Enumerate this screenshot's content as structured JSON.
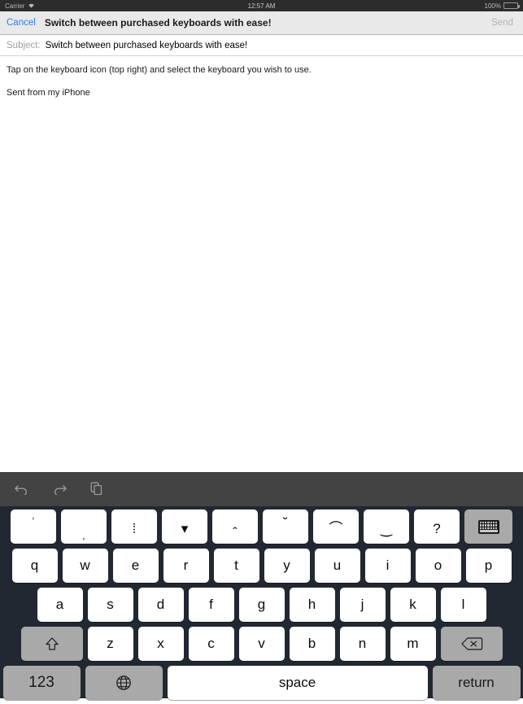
{
  "status_bar": {
    "carrier": "Carrier",
    "wifi_icon": "wifi-icon",
    "time": "12:57 AM",
    "battery_percent": "100%",
    "battery_icon": "battery-full-icon"
  },
  "nav_bar": {
    "cancel_label": "Cancel",
    "title": "Switch between purchased keyboards with ease!",
    "send_label": "Send",
    "cancel_color": "#2a7ef0",
    "send_color": "#b4b4b4"
  },
  "compose": {
    "subject_label": "Subject:",
    "subject_value": "Switch between purchased keyboards with ease!",
    "body_text": "Tap on the keyboard icon (top right) and select the keyboard you wish to use.",
    "signature": "Sent from my iPhone"
  },
  "keyboard": {
    "background_color": "#222831",
    "toolbar_color": "#434343",
    "key_color": "#ffffff",
    "modifier_key_color": "#a9a9a9",
    "toolbar": [
      {
        "name": "undo-icon",
        "label": "undo"
      },
      {
        "name": "redo-icon",
        "label": "redo"
      },
      {
        "name": "paste-icon",
        "label": "paste"
      }
    ],
    "row_accents": [
      {
        "glyph": "ˈ",
        "name": "acute-accent-key",
        "pos": "high"
      },
      {
        "glyph": "ˌ",
        "name": "cedilla-accent-key",
        "pos": "low"
      },
      {
        "glyph": "⁞",
        "name": "diaeresis-accent-key",
        "pos": "mid"
      },
      {
        "glyph": "▾",
        "name": "caron-accent-key",
        "pos": "mid"
      },
      {
        "glyph": "ˆ",
        "name": "circumflex-accent-key",
        "pos": "low"
      },
      {
        "glyph": "˘",
        "name": "breve-accent-key",
        "pos": "high"
      },
      {
        "glyph": "⌒",
        "name": "inverted-breve-accent-key",
        "pos": "mid"
      },
      {
        "glyph": "‿",
        "name": "undertie-accent-key",
        "pos": "mid"
      },
      {
        "glyph": "?",
        "name": "question-mark-key",
        "pos": "mid"
      }
    ],
    "keyboard_switch_key": "keyboard-icon",
    "row_q": [
      "q",
      "w",
      "e",
      "r",
      "t",
      "y",
      "u",
      "i",
      "o",
      "p"
    ],
    "row_a": [
      "a",
      "s",
      "d",
      "f",
      "g",
      "h",
      "j",
      "k",
      "l"
    ],
    "row_z": [
      "z",
      "x",
      "c",
      "v",
      "b",
      "n",
      "m"
    ],
    "shift_key": "shift-icon",
    "backspace_key": "backspace-icon",
    "numbers_key_label": "123",
    "globe_key": "globe-icon",
    "space_key_label": "space",
    "return_key_label": "return"
  }
}
